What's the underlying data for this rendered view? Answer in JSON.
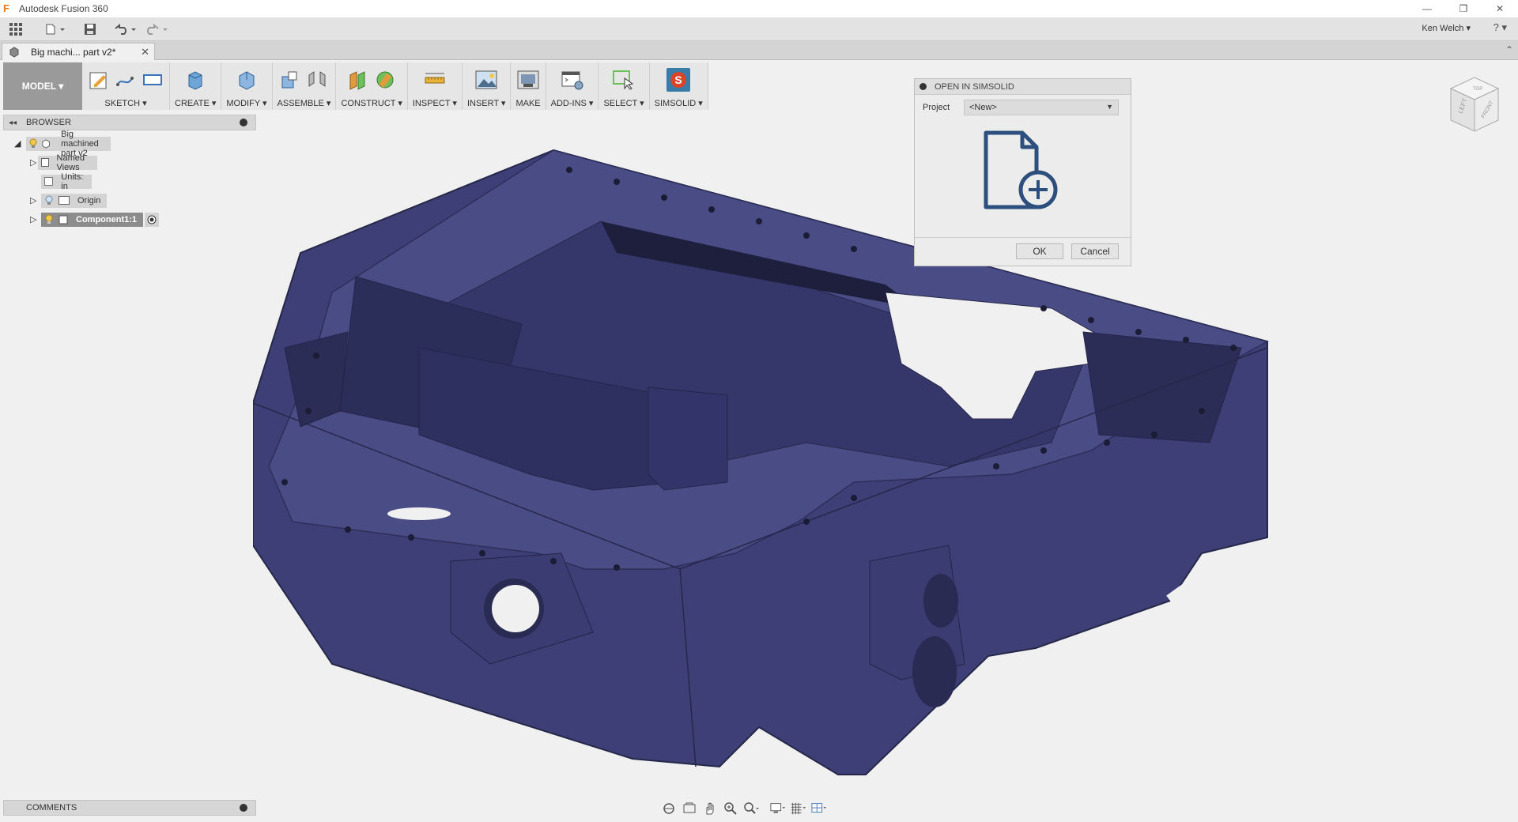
{
  "window": {
    "title": "Autodesk Fusion 360",
    "logo": "F",
    "minimize": "—",
    "restore": "❐",
    "close": "✕"
  },
  "qat": {
    "apps_icon": "grid-icon",
    "file_icon": "file-icon",
    "save_icon": "save-icon",
    "undo_icon": "undo-icon",
    "redo_icon": "redo-icon"
  },
  "header": {
    "user": "Ken Welch ▾",
    "help": "? ▾"
  },
  "tab": {
    "name": "Big machi... part v2*",
    "close": "✕",
    "collapse": "⌃"
  },
  "toolbar": {
    "workspace": "MODEL ▾",
    "groups": {
      "sketch": "SKETCH ▾",
      "create": "CREATE ▾",
      "modify": "MODIFY ▾",
      "assemble": "ASSEMBLE ▾",
      "construct": "CONSTRUCT ▾",
      "inspect": "INSPECT ▾",
      "insert": "INSERT ▾",
      "make": "MAKE",
      "addins": "ADD-INS ▾",
      "select": "SELECT ▾",
      "simsolid": "SIMSOLID ▾"
    }
  },
  "browser": {
    "title": "BROWSER",
    "collapse": "◂◂",
    "root": "Big machined part v2",
    "named_views": "Named Views",
    "units": "Units: in",
    "origin": "Origin",
    "component": "Component1:1"
  },
  "viewcube": {
    "left": "LEFT",
    "front": "FRONT",
    "top": "TOP"
  },
  "dialog": {
    "title": "OPEN IN SIMSOLID",
    "project_label": "Project",
    "project_value": "<New>",
    "ok": "OK",
    "cancel": "Cancel"
  },
  "comments": {
    "title": "COMMENTS"
  },
  "colors": {
    "model_body": "#3c3e74",
    "accent_simsolid": "#3a7ca8",
    "workspace_bg": "#f0f0f0"
  }
}
